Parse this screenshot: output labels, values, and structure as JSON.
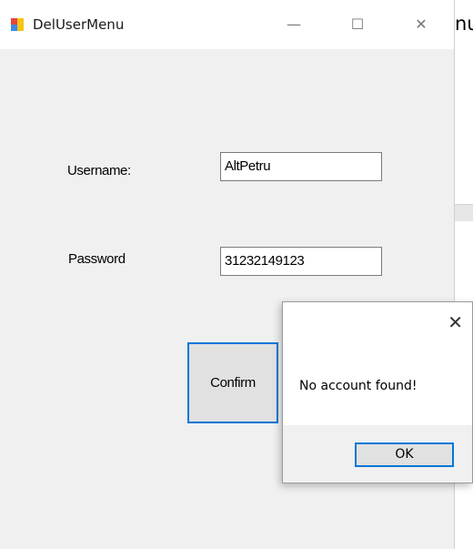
{
  "background": {
    "title_fragment": "nu"
  },
  "window": {
    "title": "DelUserMenu",
    "icon": "app-window-icon",
    "minimize_glyph": "—",
    "maximize_glyph": "☐",
    "close_glyph": "✕"
  },
  "form": {
    "username_label": "Username:",
    "username_value": "AltPetru",
    "password_label": "Password",
    "password_value": "31232149123",
    "confirm_label": "Confirm"
  },
  "message_box": {
    "close_glyph": "✕",
    "text": "No account found!",
    "ok_label": "OK"
  },
  "colors": {
    "accent": "#0078d7",
    "window_bg": "#f0f0f0",
    "titlebar_bg": "#ffffff"
  }
}
